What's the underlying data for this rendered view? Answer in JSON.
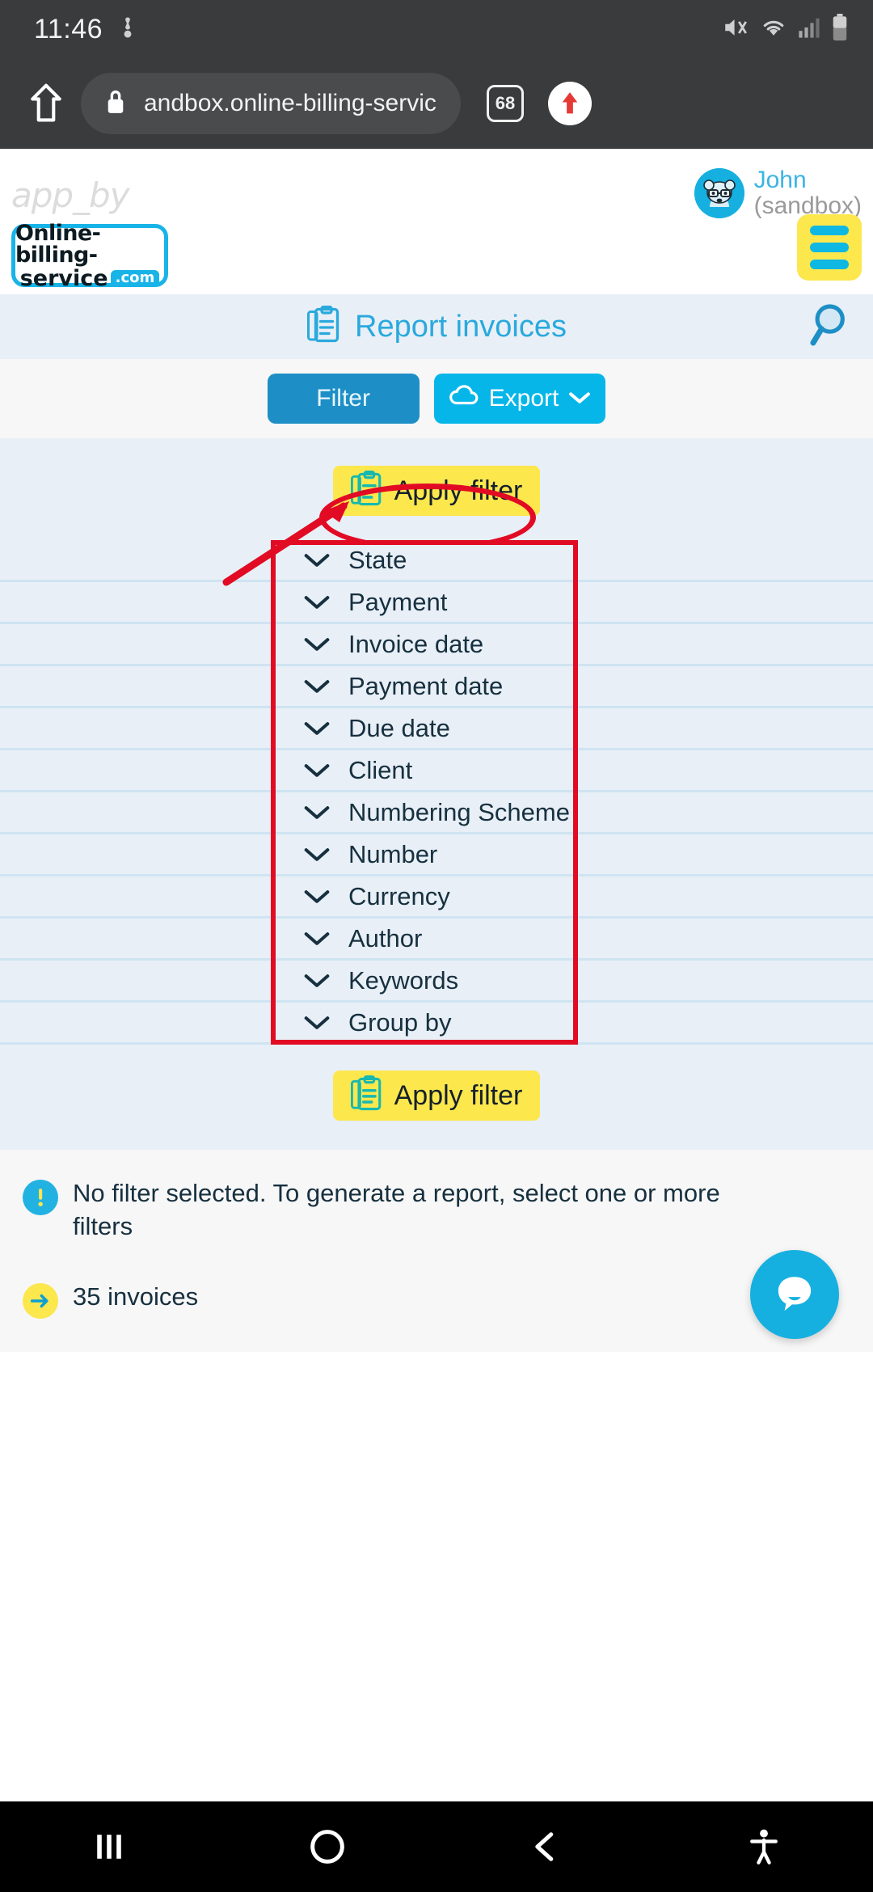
{
  "status_bar": {
    "time": "11:46",
    "icons": [
      "vibrate-off-icon",
      "mute-icon",
      "wifi-icon",
      "cellular-signal-icon",
      "battery-icon"
    ]
  },
  "browser": {
    "home_icon": "home-icon",
    "lock_icon": "lock-icon",
    "url": "andbox.online-billing-service.com",
    "tab_count": "68",
    "menu_icon": "upload-arrow-icon"
  },
  "header": {
    "app_by": "app_by",
    "user_name": "John",
    "user_env": "(sandbox)",
    "logo_line1": "Online-billing-",
    "logo_line2": "service",
    "logo_badge": ".com",
    "menu_icon": "hamburger-menu-icon"
  },
  "page": {
    "title": "Report invoices",
    "title_icon": "clipboard-icon",
    "search_icon": "search-icon"
  },
  "toolbar": {
    "filter_label": "Filter",
    "export_label": "Export",
    "export_icon": "cloud-icon",
    "export_caret": "chevron-down-icon"
  },
  "filter_panel": {
    "apply_label": "Apply filter",
    "apply_icon": "clipboard-icon",
    "apply_label_bottom": "Apply filter",
    "items": [
      {
        "label": "State"
      },
      {
        "label": "Payment"
      },
      {
        "label": "Invoice date"
      },
      {
        "label": "Payment date"
      },
      {
        "label": "Due date"
      },
      {
        "label": "Client"
      },
      {
        "label": "Numbering Scheme"
      },
      {
        "label": "Number"
      },
      {
        "label": "Currency"
      },
      {
        "label": "Author"
      },
      {
        "label": "Keywords"
      },
      {
        "label": "Group by"
      }
    ]
  },
  "notices": {
    "info_text": "No filter selected. To generate a report, select one or more filters",
    "count_text": "35 invoices",
    "info_icon": "exclamation-icon",
    "count_icon": "arrow-right-icon",
    "chat_icon": "chat-bubble-icon"
  },
  "nav_bar": {
    "recents": "recents-icon",
    "home": "home-circle-icon",
    "back": "back-icon",
    "accessibility": "accessibility-icon"
  },
  "colors": {
    "accent_cyan": "#16b0e0",
    "filter_blue": "#1e8fc6",
    "export_blue": "#06b6e8",
    "yellow": "#fce74d",
    "annotation_red": "#e20b24",
    "panel_bg": "#e8eff6"
  }
}
